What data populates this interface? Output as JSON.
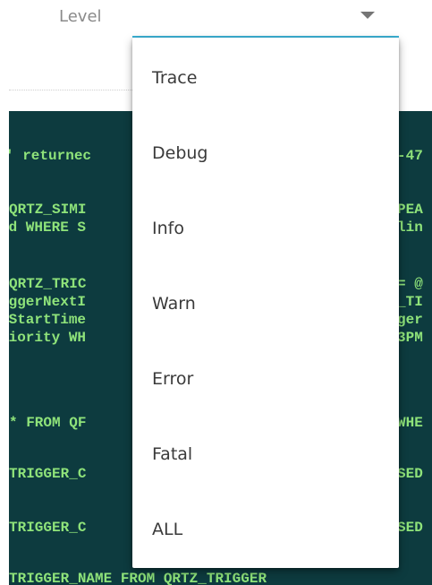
{
  "level_select": {
    "label": "Level",
    "accent_color": "#3cb4d8",
    "icon": "chevron-down-icon"
  },
  "log_panel": {
    "background_color": "#0d3b3f",
    "text_color": "#8fe37a",
    "lines": [
      "' returnec",
      "-47",
      "QRTZ_SIMI",
      "PEA",
      "ed WHERE S",
      "lin",
      "QRTZ_TRIC",
      "= @",
      "iggerNextI",
      "_TI",
      "rStartTime",
      "ger",
      "riority WH",
      "3PM",
      "* FROM QF",
      "WHE",
      "TRIGGER_C",
      "SED",
      "TRIGGER_C",
      "SED",
      "TRIGGER_NAME FROM QRTZ_TRIGGER"
    ]
  },
  "dropdown": {
    "options": [
      {
        "label": "Trace"
      },
      {
        "label": "Debug"
      },
      {
        "label": "Info"
      },
      {
        "label": "Warn"
      },
      {
        "label": "Error"
      },
      {
        "label": "Fatal"
      },
      {
        "label": "ALL"
      }
    ]
  }
}
